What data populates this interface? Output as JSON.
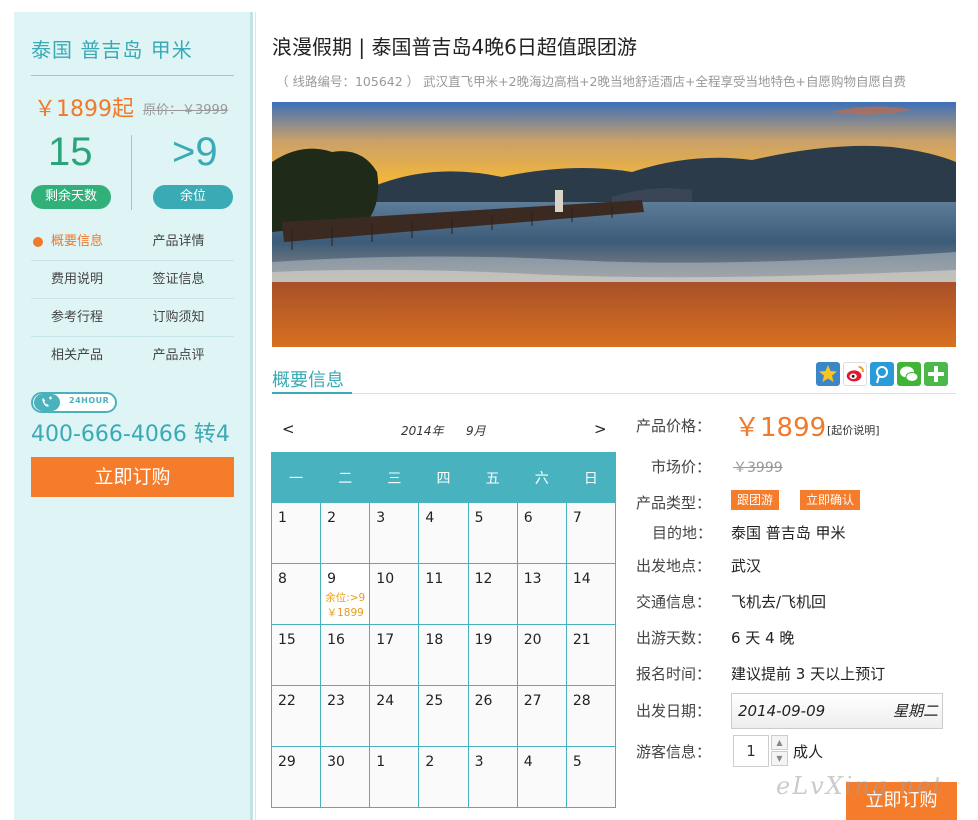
{
  "sidebar": {
    "destination": "泰国 普吉岛 甲米",
    "price": "￥1899起",
    "original_price": "原价：￥3999",
    "days_left": "15",
    "days_left_label": "剩余天数",
    "seats_left": ">9",
    "seats_left_label": "余位",
    "nav": [
      [
        "概要信息",
        "产品详情"
      ],
      [
        "费用说明",
        "签证信息"
      ],
      [
        "参考行程",
        "订购须知"
      ],
      [
        "相关产品",
        "产品点评"
      ]
    ],
    "hotline_badge": "24HOUR",
    "phone": "400-666-4066 转4",
    "book_label": "立即订购"
  },
  "main": {
    "title": "浪漫假期 | 泰国普吉岛4晚6日超值跟团游",
    "route_info": "（ 线路编号：105642 ） 武汉直飞甲米+2晚海边高档+2晚当地舒适酒店+全程享受当地特色+自愿购物自愿自费",
    "section_title": "概要信息",
    "share_icons": [
      "qzone-star-icon",
      "weibo-icon",
      "tencent-weibo-icon",
      "wechat-icon",
      "more-plus-icon"
    ],
    "book_label": "立即订购",
    "watermark": "eLvXing.net"
  },
  "calendar": {
    "prev": "<",
    "next": ">",
    "year": "2014年",
    "month": "9月",
    "weekdays": [
      "一",
      "二",
      "三",
      "四",
      "五",
      "六",
      "日"
    ],
    "weeks": [
      [
        "1",
        "2",
        "3",
        "4",
        "5",
        "6",
        "7"
      ],
      [
        "8",
        "9",
        "10",
        "11",
        "12",
        "13",
        "14"
      ],
      [
        "15",
        "16",
        "17",
        "18",
        "19",
        "20",
        "21"
      ],
      [
        "22",
        "23",
        "24",
        "25",
        "26",
        "27",
        "28"
      ],
      [
        "29",
        "30",
        "1",
        "2",
        "3",
        "4",
        "5"
      ]
    ],
    "available": {
      "day": "9",
      "seats": "余位:>9",
      "price": "￥1899"
    }
  },
  "info": {
    "price_label": "产品价格：",
    "price": "￥1899",
    "price_note": "[起价说明]",
    "market_label": "市场价：",
    "market_price": "￥3999",
    "type_label": "产品类型：",
    "tags": [
      "跟团游",
      "立即确认"
    ],
    "dest_label": "目的地：",
    "dest": "泰国 普吉岛 甲米",
    "depart_label": "出发地点：",
    "depart": "武汉",
    "transport_label": "交通信息：",
    "transport": "飞机去/飞机回",
    "days_label": "出游天数：",
    "days": "6 天 4 晚",
    "signup_label": "报名时间：",
    "signup": "建议提前 3 天以上预订",
    "date_label": "出发日期：",
    "date": "2014-09-09",
    "weekday": "星期二",
    "tourist_label": "游客信息：",
    "qty": "1",
    "qty_unit": "成人"
  },
  "colors": {
    "accent_teal": "#3aaab5",
    "accent_orange": "#f07a2a",
    "green": "#32b07a",
    "sidebar_bg": "#dff4f5"
  }
}
